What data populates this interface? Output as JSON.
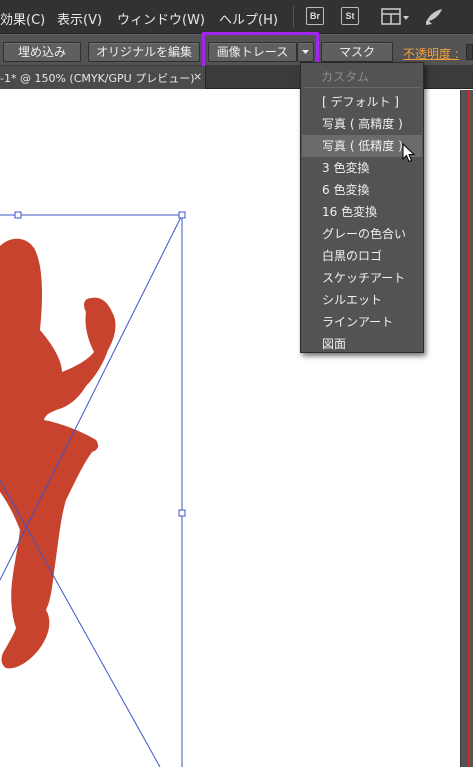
{
  "menubar": {
    "items": [
      "効果(C)",
      "表示(V)",
      "ウィンドウ(W)",
      "ヘルプ(H)"
    ],
    "icons": [
      {
        "name": "bridge-icon",
        "label": "Br"
      },
      {
        "name": "stock-icon",
        "label": "St"
      },
      {
        "name": "workspace-layout-icon"
      },
      {
        "name": "sync-icon"
      }
    ]
  },
  "control_bar": {
    "embed_label": "埋め込み",
    "edit_original_label": "オリジナルを編集",
    "image_trace_label": "画像トレース",
    "mask_label": "マスク",
    "opacity_label": "不透明度 :",
    "highlight_color": "#a524f0"
  },
  "document_tab": {
    "title": "-1* @ 150% (CMYK/GPU プレビュー)",
    "close": "×"
  },
  "trace_dropdown": {
    "header": "カスタム",
    "items": [
      "[ デフォルト ]",
      "写真 ( 高精度 )",
      "写真 ( 低精度 )",
      "3 色変換",
      "6 色変換",
      "16 色変換",
      "グレーの色合い",
      "白黒のロゴ",
      "スケッチアート",
      "シルエット",
      "ラインアート",
      "図面"
    ],
    "hovered_index": 2
  },
  "canvas": {
    "silhouette_color": "#c8432e",
    "selection_color": "#3d55c8"
  }
}
